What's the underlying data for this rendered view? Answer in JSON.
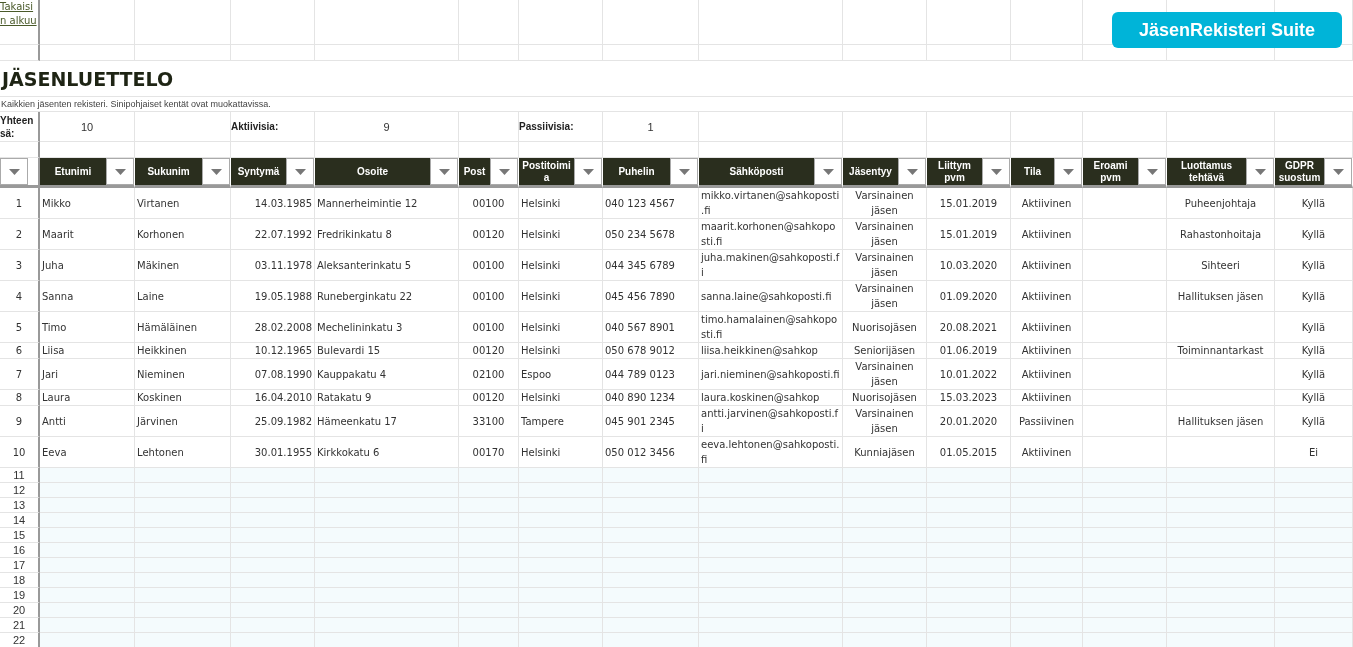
{
  "back_link": "Takaisin alkuu",
  "app_badge": "JäsenRekisteri Suite",
  "title": "JÄSENLUETTELO",
  "subtitle": "Kaikkien jäsenten rekisteri. Sinipohjaiset kentät ovat muokattavissa.",
  "stats": [
    {
      "label": "Yhteensä:",
      "value": "10"
    },
    {
      "label": "Aktiivisia:",
      "value": "9"
    },
    {
      "label": "Passiivisia:",
      "value": "1"
    }
  ],
  "table": {
    "columns": [
      {
        "label": "Etunimi"
      },
      {
        "label": "Sukunim"
      },
      {
        "label": "Syntymä"
      },
      {
        "label": "Osoite"
      },
      {
        "label": "Post"
      },
      {
        "label": "Postitoimi a"
      },
      {
        "label": "Puhelin"
      },
      {
        "label": "Sähköposti"
      },
      {
        "label": "Jäsentyy"
      },
      {
        "label": "Liittym pvm"
      },
      {
        "label": "Tila"
      },
      {
        "label": "Eroami pvm"
      },
      {
        "label": "Luottamus tehtävä"
      },
      {
        "label": "GDPR suostum"
      }
    ],
    "rows": [
      {
        "number": "1",
        "cells": [
          "Mikko",
          "Virtanen",
          "14.03.1985",
          "Mannerheimintie 12",
          "00100",
          "Helsinki",
          "040 123 4567",
          "mikko.virtanen@sahkoposti.fi",
          "Varsinainen jäsen",
          "15.01.2019",
          "Aktiivinen",
          "",
          "Puheenjohtaja",
          "Kyllä"
        ]
      },
      {
        "number": "2",
        "cells": [
          "Maarit",
          "Korhonen",
          "22.07.1992",
          "Fredrikinkatu 8",
          "00120",
          "Helsinki",
          "050 234 5678",
          "maarit.korhonen@sahkoposti.fi",
          "Varsinainen jäsen",
          "15.01.2019",
          "Aktiivinen",
          "",
          "Rahastonhoitaja",
          "Kyllä"
        ]
      },
      {
        "number": "3",
        "cells": [
          "Juha",
          "Mäkinen",
          "03.11.1978",
          "Aleksanterinkatu 5",
          "00100",
          "Helsinki",
          "044 345 6789",
          "juha.makinen@sahkoposti.fi",
          "Varsinainen jäsen",
          "10.03.2020",
          "Aktiivinen",
          "",
          "Sihteeri",
          "Kyllä"
        ]
      },
      {
        "number": "4",
        "cells": [
          "Sanna",
          "Laine",
          "19.05.1988",
          "Runeberginkatu 22",
          "00100",
          "Helsinki",
          "045 456 7890",
          "sanna.laine@sahkoposti.fi",
          "Varsinainen jäsen",
          "01.09.2020",
          "Aktiivinen",
          "",
          "Hallituksen jäsen",
          "Kyllä"
        ]
      },
      {
        "number": "5",
        "cells": [
          "Timo",
          "Hämäläinen",
          "28.02.2008",
          "Mechelininkatu 3",
          "00100",
          "Helsinki",
          "040 567 8901",
          "timo.hamalainen@sahkoposti.fi",
          "Nuorisojäsen",
          "20.08.2021",
          "Aktiivinen",
          "",
          "",
          "Kyllä"
        ]
      },
      {
        "number": "6",
        "cells": [
          "Liisa",
          "Heikkinen",
          "10.12.1965",
          "Bulevardi 15",
          "00120",
          "Helsinki",
          "050 678 9012",
          "liisa.heikkinen@sahkop",
          "Seniorijäsen",
          "01.06.2019",
          "Aktiivinen",
          "",
          "Toiminnantarkast",
          "Kyllä"
        ]
      },
      {
        "number": "7",
        "cells": [
          "Jari",
          "Nieminen",
          "07.08.1990",
          "Kauppakatu 4",
          "02100",
          "Espoo",
          "044 789 0123",
          "jari.nieminen@sahkoposti.fi",
          "Varsinainen jäsen",
          "10.01.2022",
          "Aktiivinen",
          "",
          "",
          "Kyllä"
        ]
      },
      {
        "number": "8",
        "cells": [
          "Laura",
          "Koskinen",
          "16.04.2010",
          "Ratakatu 9",
          "00120",
          "Helsinki",
          "040 890 1234",
          "laura.koskinen@sahkop",
          "Nuorisojäsen",
          "15.03.2023",
          "Aktiivinen",
          "",
          "",
          "Kyllä"
        ]
      },
      {
        "number": "9",
        "cells": [
          "Antti",
          "Järvinen",
          "25.09.1982",
          "Hämeenkatu 17",
          "33100",
          "Tampere",
          "045 901 2345",
          "antti.jarvinen@sahkoposti.fi",
          "Varsinainen jäsen",
          "20.01.2020",
          "Passiivinen",
          "",
          "Hallituksen jäsen",
          "Kyllä"
        ]
      },
      {
        "number": "10",
        "cells": [
          "Eeva",
          "Lehtonen",
          "30.01.1955",
          "Kirkkokatu 6",
          "00170",
          "Helsinki",
          "050 012 3456",
          "eeva.lehtonen@sahkoposti.fi",
          "Kunniajäsen",
          "01.05.2015",
          "Aktiivinen",
          "",
          "",
          "Ei"
        ]
      }
    ],
    "empty_rows": [
      "11",
      "12",
      "13",
      "14",
      "15",
      "16",
      "17",
      "18",
      "19",
      "20",
      "21",
      "22"
    ]
  }
}
